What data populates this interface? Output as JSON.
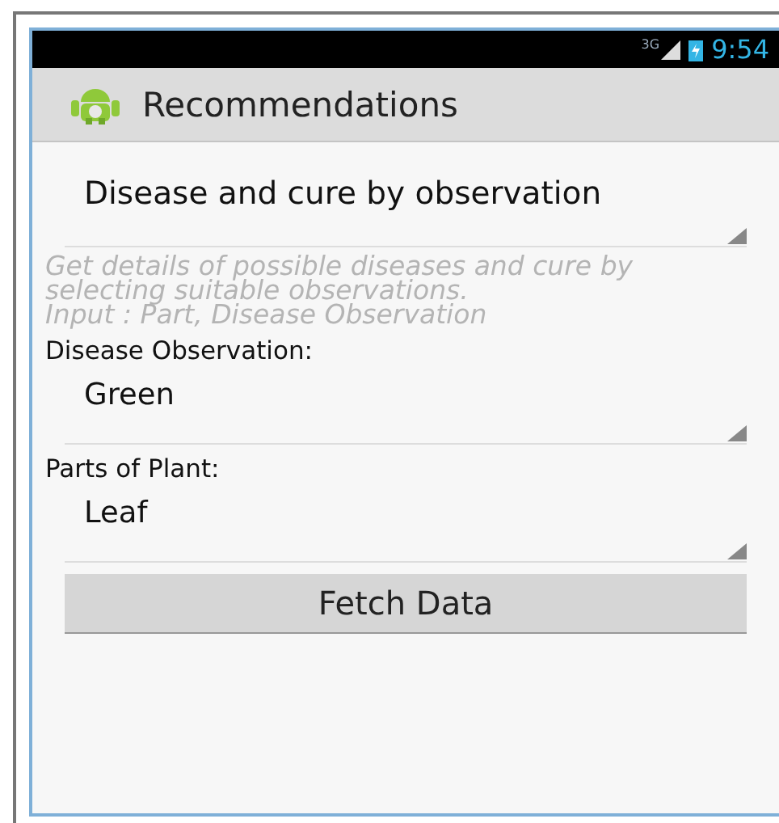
{
  "status_bar": {
    "network": "3G",
    "time": "9:54"
  },
  "action_bar": {
    "title": "Recommendations"
  },
  "form": [
    {
      "kind": "mode_spinner",
      "value": "Disease and cure by observation"
    },
    {
      "kind": "hint",
      "text": "Get details of possible diseases and cure by\nselecting suitable observations.\n Input : Part, Disease Observation"
    },
    {
      "kind": "label",
      "text": "Disease Observation:"
    },
    {
      "kind": "spinner",
      "value": "Green"
    },
    {
      "kind": "label",
      "text": "Parts of Plant:"
    },
    {
      "kind": "spinner",
      "value": "Leaf"
    },
    {
      "kind": "button",
      "text": "Fetch Data"
    }
  ]
}
